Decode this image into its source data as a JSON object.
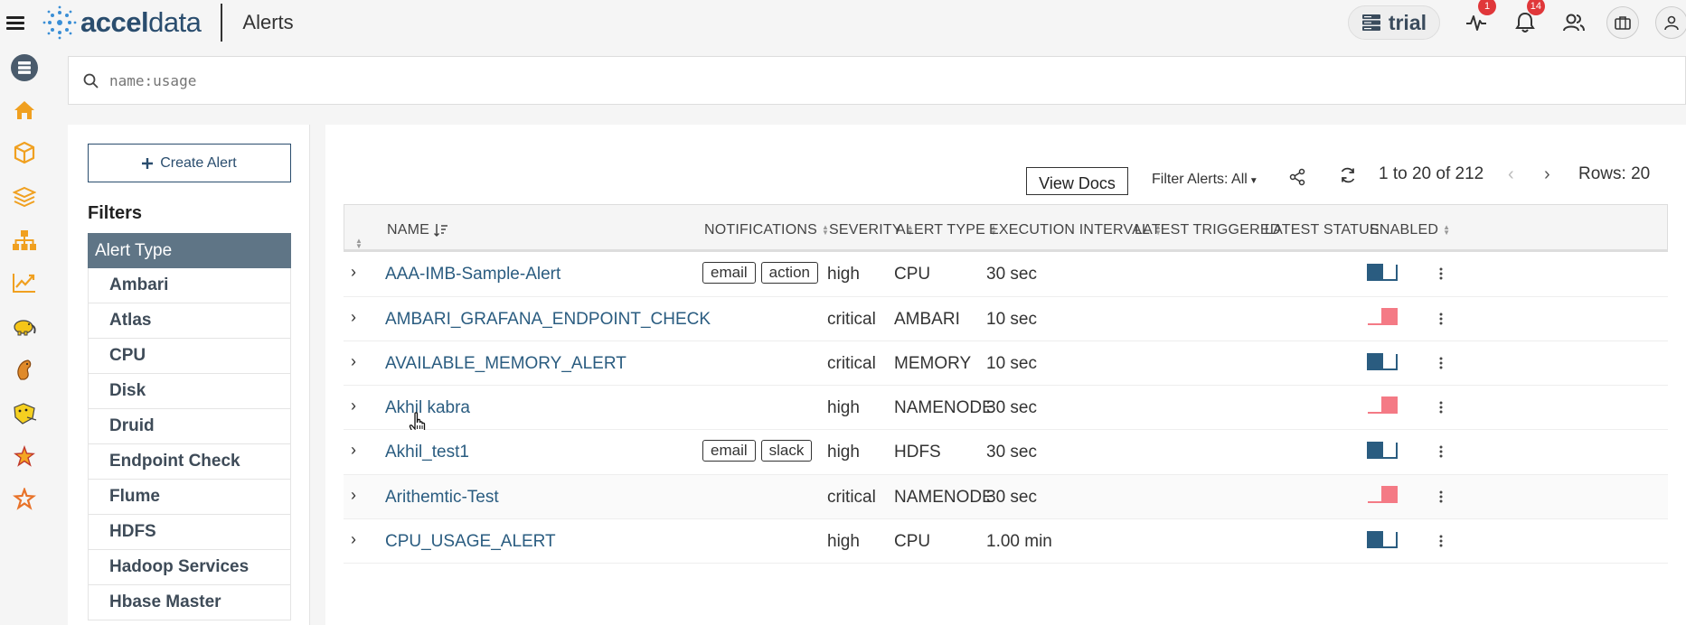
{
  "app": {
    "brand_prefix": "accel",
    "brand_suffix": "data",
    "page_title": "Alerts",
    "env_label": "trial",
    "activity_badge": "1",
    "notification_badge": "14"
  },
  "search": {
    "placeholder": "name:usage"
  },
  "filters": {
    "create_button_label": "Create Alert",
    "title": "Filters",
    "group_label": "Alert Type",
    "items": [
      "Ambari",
      "Atlas",
      "CPU",
      "Disk",
      "Druid",
      "Endpoint Check",
      "Flume",
      "HDFS",
      "Hadoop Services",
      "Hbase Master"
    ]
  },
  "toolbar": {
    "view_docs_label": "View Docs",
    "filter_alerts_label": "Filter Alerts: All",
    "pager_text": "1 to 20 of 212",
    "rows_text": "Rows: 20"
  },
  "table": {
    "columns": {
      "name": "NAME",
      "notifications": "NOTIFICATIONS",
      "severity": "SEVERITY",
      "alert_type": "ALERT TYPE",
      "execution_interval": "EXECUTION INTERVAL",
      "latest_triggered": "LATEST TRIGGERED",
      "latest_status": "LATEST STATUS",
      "enabled": "ENABLED"
    },
    "rows": [
      {
        "name": "AAA-IMB-Sample-Alert",
        "notifications": [
          "email",
          "action"
        ],
        "severity": "high",
        "alert_type": "CPU",
        "interval": "30 sec",
        "enabled": true
      },
      {
        "name": "AMBARI_GRAFANA_ENDPOINT_CHECK",
        "notifications": [],
        "severity": "critical",
        "alert_type": "AMBARI",
        "interval": "10 sec",
        "enabled": false
      },
      {
        "name": "AVAILABLE_MEMORY_ALERT",
        "notifications": [],
        "severity": "critical",
        "alert_type": "MEMORY",
        "interval": "10 sec",
        "enabled": true
      },
      {
        "name": "Akhil kabra",
        "notifications": [],
        "severity": "high",
        "alert_type": "NAMENODE",
        "interval": "30 sec",
        "enabled": false
      },
      {
        "name": "Akhil_test1",
        "notifications": [
          "email",
          "slack"
        ],
        "severity": "high",
        "alert_type": "HDFS",
        "interval": "30 sec",
        "enabled": true
      },
      {
        "name": "Arithemtic-Test",
        "notifications": [],
        "severity": "critical",
        "alert_type": "NAMENODE",
        "interval": "30 sec",
        "enabled": false
      },
      {
        "name": "CPU_USAGE_ALERT",
        "notifications": [],
        "severity": "high",
        "alert_type": "CPU",
        "interval": "1.00 min",
        "enabled": true
      }
    ]
  },
  "colors": {
    "brand": "#2a4d6e",
    "link": "#2a5c80",
    "toggle_on": "#2a5c80",
    "toggle_off": "#f47a85",
    "badge": "#e0373a",
    "filter_head": "#5f7586",
    "rail_icon": "#f0a020"
  }
}
